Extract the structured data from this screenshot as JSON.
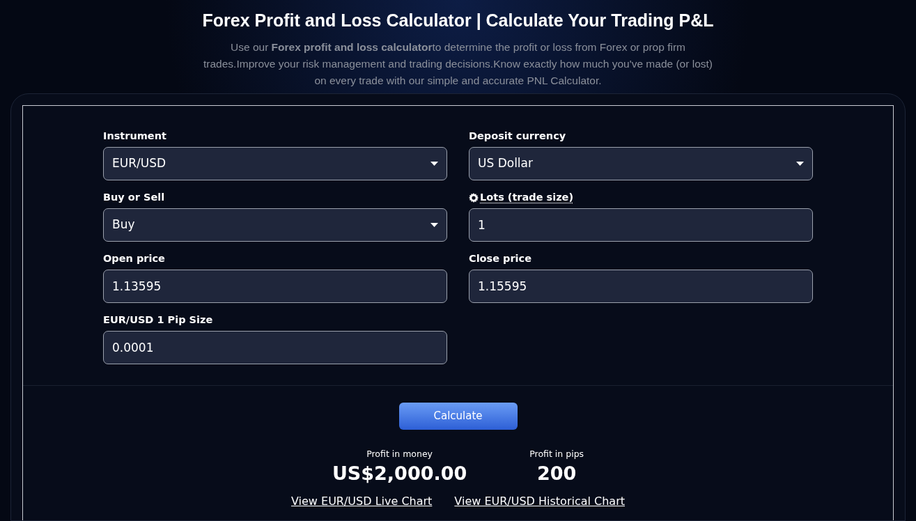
{
  "title": "Forex Profit and Loss Calculator | Calculate Your Trading P&L",
  "intro": "Use our **Forex profit and loss calculator**to determine the profit or loss from Forex or prop firm trades.Improve your risk management and trading decisions.Know exactly how much you've made (or lost) on every trade with our simple and accurate PNL Calculator.",
  "fields": [
    {
      "kind": "select",
      "label": "Instrument",
      "value": "EUR/USD"
    },
    {
      "kind": "select",
      "label": "Deposit currency",
      "value": "US Dollar"
    },
    {
      "kind": "select",
      "label": "Buy or Sell",
      "value": "Buy"
    },
    {
      "kind": "input",
      "label": "Lots (trade size)",
      "value": "1",
      "info": true
    },
    {
      "kind": "input",
      "label": "Open price",
      "value": "1.13595"
    },
    {
      "kind": "input",
      "label": "Close price",
      "value": "1.15595"
    },
    {
      "kind": "input",
      "label": "EUR/USD 1 Pip Size",
      "value": "0.0001"
    }
  ],
  "calculate_button": "Calculate",
  "results": [
    {
      "label": "Profit in money",
      "value": "US$2,000.00"
    },
    {
      "label": "Profit in pips",
      "value": "200"
    }
  ],
  "links": [
    "View EUR/USD Live Chart",
    "View EUR/USD Historical Chart"
  ]
}
